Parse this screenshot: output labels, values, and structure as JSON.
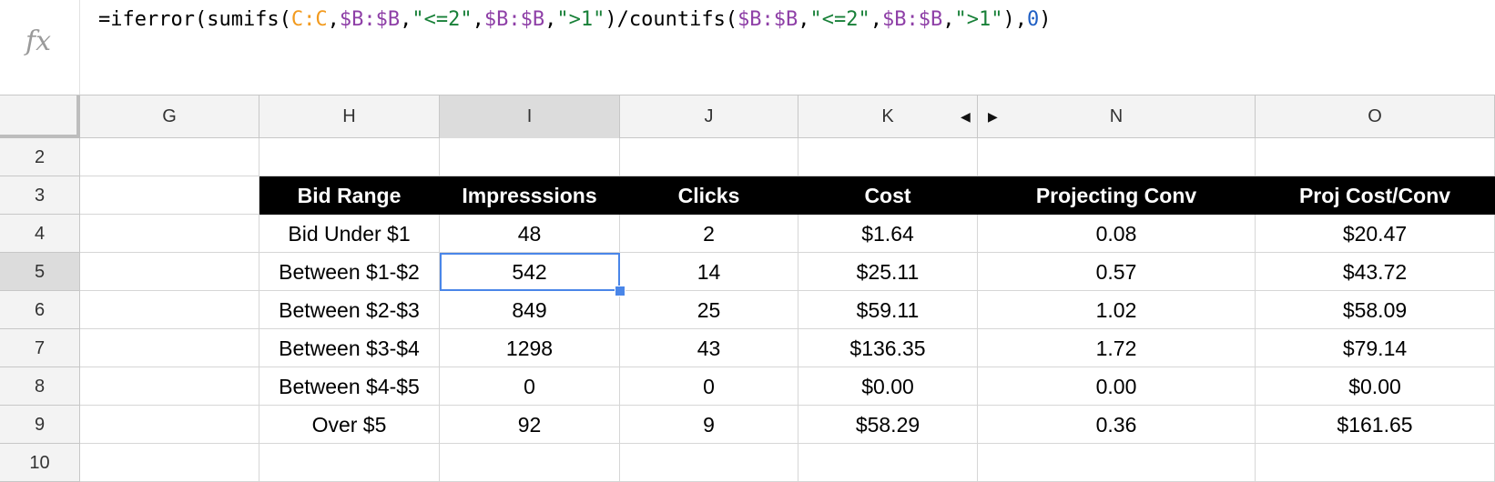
{
  "formula_bar": {
    "fx_icon": "fx-icon",
    "tokens": [
      {
        "text": "=iferror(sumifs(",
        "kind": "plain"
      },
      {
        "text": "C:C",
        "kind": "range-c"
      },
      {
        "text": ",",
        "kind": "plain"
      },
      {
        "text": "$B:$B",
        "kind": "range-b"
      },
      {
        "text": ",",
        "kind": "plain"
      },
      {
        "text": "\"<=2\"",
        "kind": "str"
      },
      {
        "text": ",",
        "kind": "plain"
      },
      {
        "text": "$B:$B",
        "kind": "range-b"
      },
      {
        "text": ",",
        "kind": "plain"
      },
      {
        "text": "\">1\"",
        "kind": "str"
      },
      {
        "text": ")/countifs(",
        "kind": "plain"
      },
      {
        "text": "$B:$B",
        "kind": "range-b"
      },
      {
        "text": ",",
        "kind": "plain"
      },
      {
        "text": "\"<=2\"",
        "kind": "str"
      },
      {
        "text": ",",
        "kind": "plain"
      },
      {
        "text": "$B:$B",
        "kind": "range-b"
      },
      {
        "text": ",",
        "kind": "plain"
      },
      {
        "text": "\">1\"",
        "kind": "str"
      },
      {
        "text": "),",
        "kind": "plain"
      },
      {
        "text": "0",
        "kind": "num"
      },
      {
        "text": ")",
        "kind": "plain"
      }
    ]
  },
  "column_headers": [
    "G",
    "H",
    "I",
    "J",
    "K",
    "N",
    "O"
  ],
  "selected_column": "I",
  "row_numbers": [
    "2",
    "3",
    "4",
    "5",
    "6",
    "7",
    "8",
    "9",
    "10"
  ],
  "selected_row": "5",
  "table": {
    "headers": [
      "Bid Range",
      "Impresssions",
      "Clicks",
      "Cost",
      "Projecting Conv",
      "Proj Cost/Conv"
    ],
    "rows": [
      [
        "Bid Under $1",
        "48",
        "2",
        "$1.64",
        "0.08",
        "$20.47"
      ],
      [
        "Between $1-$2",
        "542",
        "14",
        "$25.11",
        "0.57",
        "$43.72"
      ],
      [
        "Between $2-$3",
        "849",
        "25",
        "$59.11",
        "1.02",
        "$58.09"
      ],
      [
        "Between $3-$4",
        "1298",
        "43",
        "$136.35",
        "1.72",
        "$79.14"
      ],
      [
        "Between $4-$5",
        "0",
        "0",
        "$0.00",
        "0.00",
        "$0.00"
      ],
      [
        "Over $5",
        "92",
        "9",
        "$58.29",
        "0.36",
        "$161.65"
      ]
    ]
  },
  "colors": {
    "selection": "#4a86e8",
    "header_fill": "#000000",
    "range_c": "#f29a1d",
    "range_b": "#8e3fa7",
    "string": "#188038",
    "number": "#1f5fc4"
  }
}
